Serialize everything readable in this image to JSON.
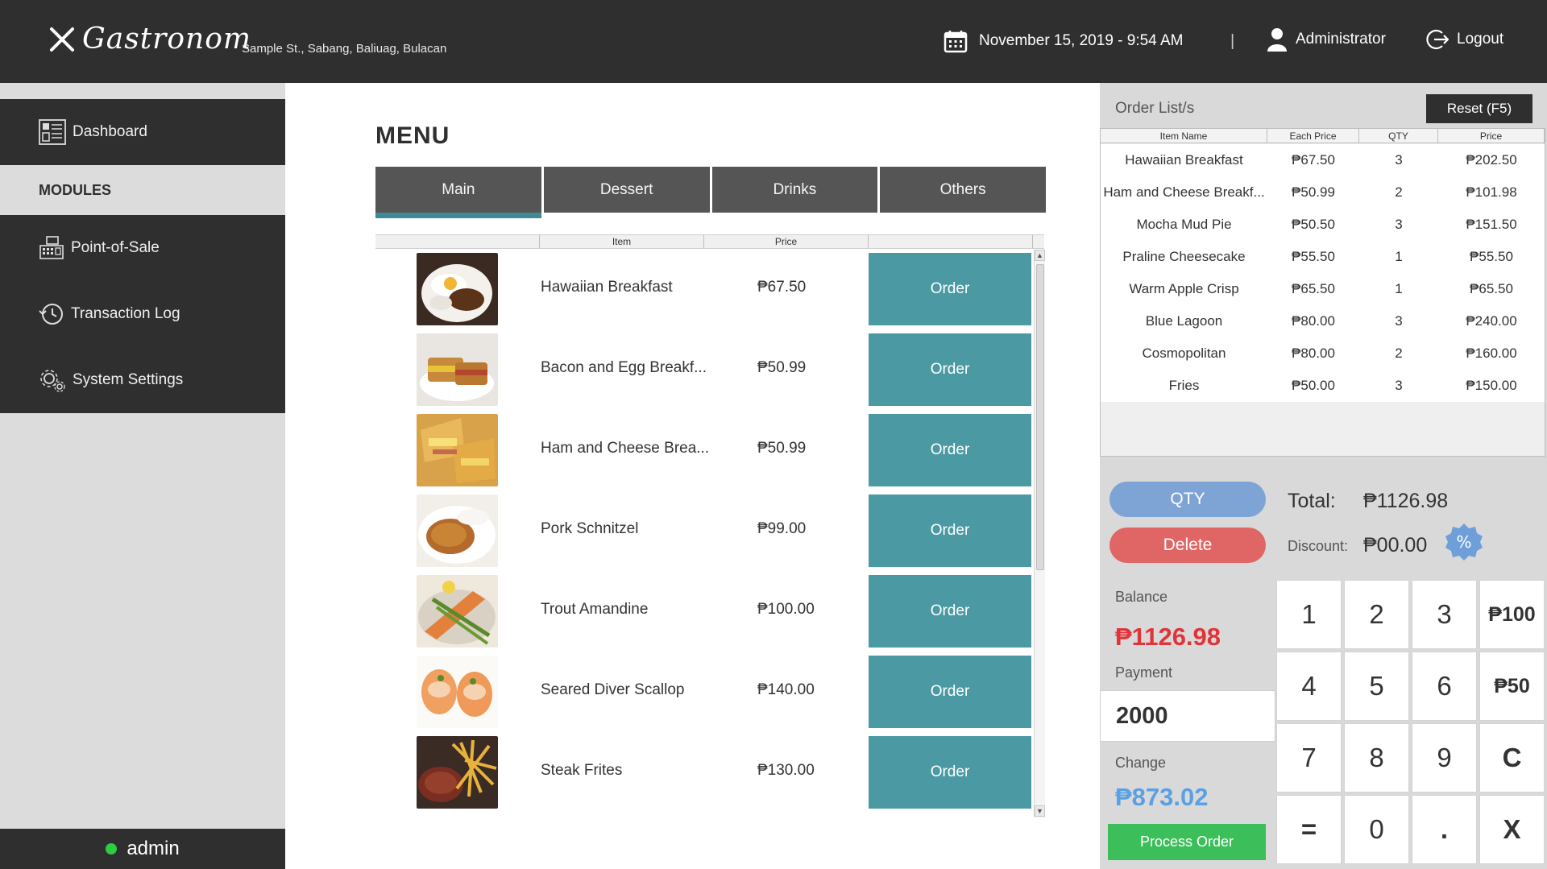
{
  "header": {
    "brand": "Gastronom",
    "address": "Sample St., Sabang, Baliuag, Bulacan",
    "datetime": "November 15, 2019 - 9:54 AM",
    "separator": "|",
    "user": "Administrator",
    "logout": "Logout"
  },
  "sidebar": {
    "dashboard": "Dashboard",
    "modules_label": "MODULES",
    "items": [
      {
        "label": "Point-of-Sale",
        "icon": "cash-register-icon"
      },
      {
        "label": "Transaction Log",
        "icon": "history-icon"
      },
      {
        "label": "System Settings",
        "icon": "gear-icon"
      }
    ],
    "status_user": "admin",
    "status_color": "#2ecc40"
  },
  "menu": {
    "title": "MENU",
    "tabs": [
      "Main",
      "Dessert",
      "Drinks",
      "Others"
    ],
    "active_tab": "Main",
    "columns": [
      "",
      "Item",
      "Price",
      ""
    ],
    "order_label": "Order",
    "items": [
      {
        "name": "Hawaiian Breakfast",
        "price": "₱67.50"
      },
      {
        "name": "Bacon and Egg Breakf...",
        "price": "₱50.99"
      },
      {
        "name": "Ham and Cheese Brea...",
        "price": "₱50.99"
      },
      {
        "name": "Pork Schnitzel",
        "price": "₱99.00"
      },
      {
        "name": "Trout Amandine",
        "price": "₱100.00"
      },
      {
        "name": "Seared Diver Scallop",
        "price": "₱140.00"
      },
      {
        "name": "Steak Frites",
        "price": "₱130.00"
      }
    ]
  },
  "order": {
    "title": "Order List/s",
    "reset_label": "Reset (F5)",
    "columns": [
      "Item Name",
      "Each Price",
      "QTY",
      "Price"
    ],
    "rows": [
      {
        "name": "Hawaiian Breakfast",
        "each": "₱67.50",
        "qty": "3",
        "price": "₱202.50"
      },
      {
        "name": "Ham and Cheese Breakf...",
        "each": "₱50.99",
        "qty": "2",
        "price": "₱101.98"
      },
      {
        "name": "Mocha Mud Pie",
        "each": "₱50.50",
        "qty": "3",
        "price": "₱151.50"
      },
      {
        "name": "Praline Cheesecake",
        "each": "₱55.50",
        "qty": "1",
        "price": "₱55.50"
      },
      {
        "name": "Warm Apple Crisp",
        "each": "₱65.50",
        "qty": "1",
        "price": "₱65.50"
      },
      {
        "name": "Blue Lagoon",
        "each": "₱80.00",
        "qty": "3",
        "price": "₱240.00"
      },
      {
        "name": "Cosmopolitan",
        "each": "₱80.00",
        "qty": "2",
        "price": "₱160.00"
      },
      {
        "name": "Fries",
        "each": "₱50.00",
        "qty": "3",
        "price": "₱150.00"
      }
    ]
  },
  "totals": {
    "qty_label": "QTY",
    "delete_label": "Delete",
    "total_label": "Total:",
    "total_value": "₱1126.98",
    "discount_label": "Discount:",
    "discount_value": "₱00.00",
    "discount_icon": "%",
    "balance_label": "Balance",
    "balance_value": "₱1126.98",
    "payment_label": "Payment",
    "payment_value": "2000",
    "change_label": "Change",
    "change_value": "₱873.02",
    "process_label": "Process Order"
  },
  "keypad": [
    "1",
    "2",
    "3",
    "₱100",
    "4",
    "5",
    "6",
    "₱50",
    "7",
    "8",
    "9",
    "C",
    "=",
    "0",
    ".",
    "X"
  ],
  "colors": {
    "dark": "#2f2f2f",
    "accent": "#4b9aa3",
    "balance": "#e0343a",
    "change": "#5aa0e6",
    "process": "#3cbf5a",
    "qty": "#7ea4d6",
    "delete": "#e06666"
  }
}
